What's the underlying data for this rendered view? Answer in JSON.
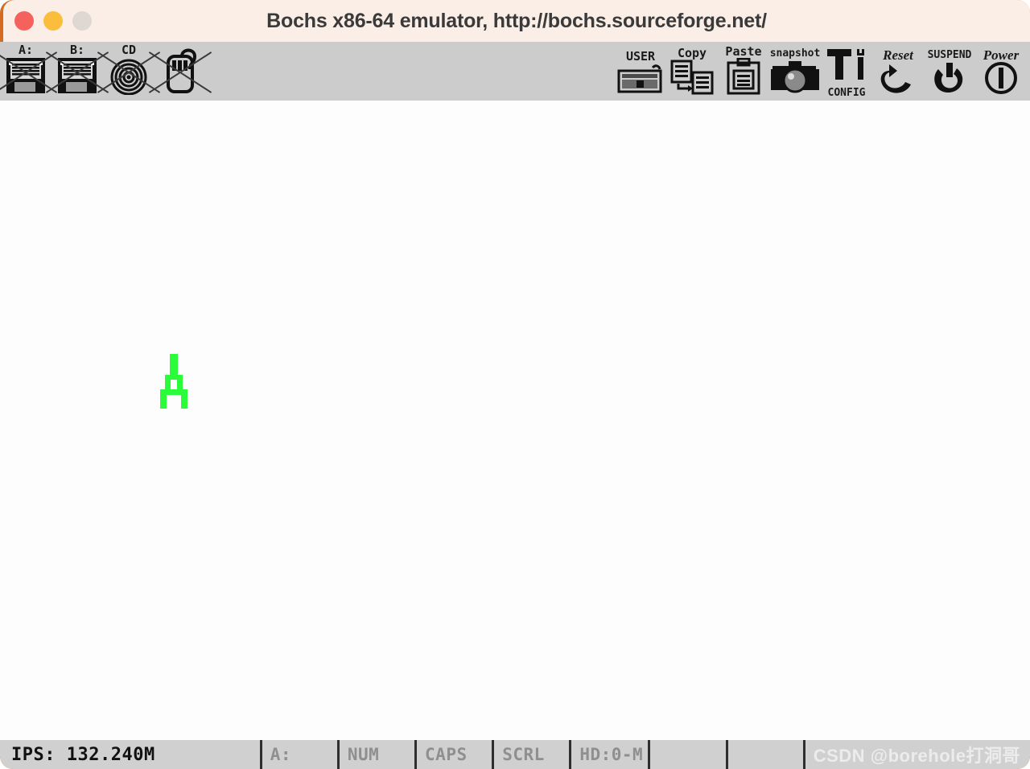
{
  "window": {
    "title": "Bochs x86-64 emulator, http://bochs.sourceforge.net/",
    "border_color": "#d46b1e",
    "titlebar_bg": "#fbeee6",
    "traffic_lights": [
      {
        "name": "close",
        "color": "#f5615c"
      },
      {
        "name": "minimize",
        "color": "#fbbd3c"
      },
      {
        "name": "zoom",
        "color": "#ddd8d2"
      }
    ]
  },
  "toolbar": {
    "bg": "#cccccc",
    "left_items": [
      {
        "label": "A:",
        "icon": "floppy-disk-icon",
        "disabled": true
      },
      {
        "label": "B:",
        "icon": "floppy-disk-icon",
        "disabled": true
      },
      {
        "label": "CD",
        "icon": "cdrom-icon",
        "disabled": true
      },
      {
        "label": "",
        "icon": "mouse-icon",
        "disabled": true
      }
    ],
    "right_items": [
      {
        "label": "USER",
        "icon": "keyboard-icon",
        "disabled": false
      },
      {
        "label": "Copy",
        "icon": "copy-icon",
        "disabled": false
      },
      {
        "label": "Paste",
        "icon": "paste-icon",
        "disabled": false
      },
      {
        "label": "snapshot",
        "icon": "camera-icon",
        "disabled": false
      },
      {
        "label": "CONFIG",
        "icon": "tools-icon",
        "disabled": false
      },
      {
        "label": "Reset",
        "icon": "reset-arrow-icon",
        "disabled": false
      },
      {
        "label": "SUSPEND",
        "icon": "suspend-power-icon",
        "disabled": false
      },
      {
        "label": "Power",
        "icon": "power-circle-icon",
        "disabled": false
      }
    ]
  },
  "screen": {
    "bg": "#fdfdfd",
    "glyph_color": "#2bfc3a",
    "glyph_name": "green-tower-glyph"
  },
  "statusbar": {
    "bg": "#d0d0d0",
    "ips": "IPS:  132.240M",
    "indicators": [
      {
        "label": "A:",
        "active": false
      },
      {
        "label": "NUM",
        "active": false
      },
      {
        "label": "CAPS",
        "active": false
      },
      {
        "label": "SCRL",
        "active": false
      },
      {
        "label": "HD:0-M",
        "active": false
      }
    ],
    "watermark": "CSDN @borehole打洞哥"
  }
}
